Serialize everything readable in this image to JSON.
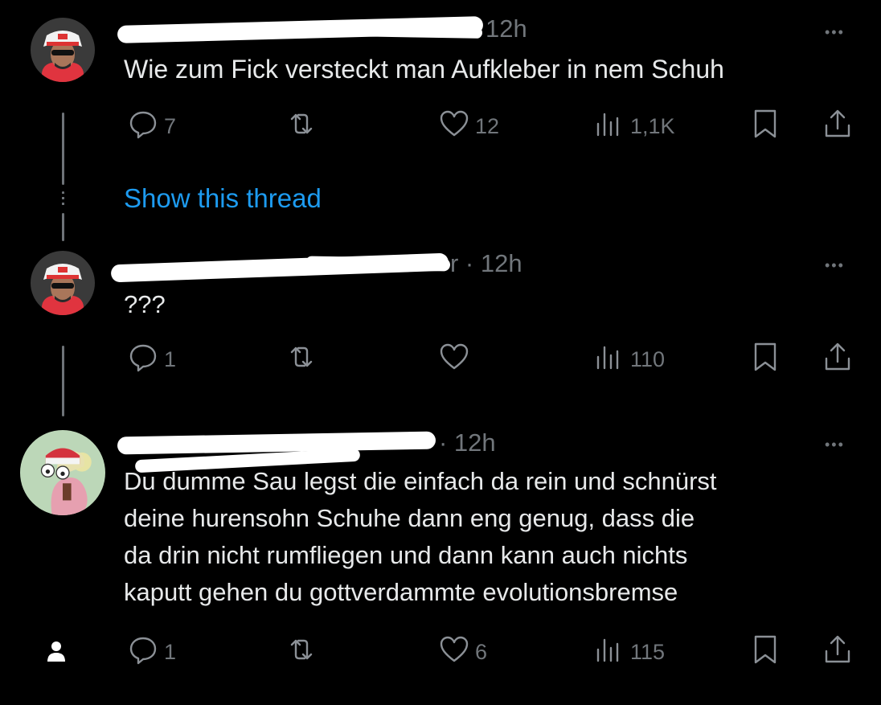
{
  "tweets": [
    {
      "time": "12h",
      "text": "Wie zum Fick versteckt man Aufkleber in nem Schuh",
      "replies": "7",
      "retweets": "",
      "likes": "12",
      "views": "1,1K"
    },
    {
      "time": "r · 12h",
      "text": "???",
      "replies": "1",
      "retweets": "",
      "likes": "",
      "views": "110"
    },
    {
      "time": "· 12h",
      "text_lines": [
        "Du dumme Sau legst die einfach da rein und schnürst",
        "deine hurensohn Schuhe dann eng genug, dass die",
        "da drin nicht rumfliegen und dann kann auch nichts",
        "kaputt gehen du gottverdammte evolutionsbremse"
      ],
      "replies": "1",
      "retweets": "",
      "likes": "6",
      "views": "115"
    }
  ],
  "show_thread": "Show this thread",
  "more_glyph": "•••",
  "icons": {
    "reply": "reply-icon",
    "retweet": "retweet-icon",
    "like": "heart-icon",
    "views": "views-icon",
    "bookmark": "bookmark-icon",
    "share": "share-icon",
    "profile": "person-icon"
  },
  "colors": {
    "background": "#000000",
    "text": "#e7e9ea",
    "muted": "#71767b",
    "link": "#1d9bf0"
  }
}
